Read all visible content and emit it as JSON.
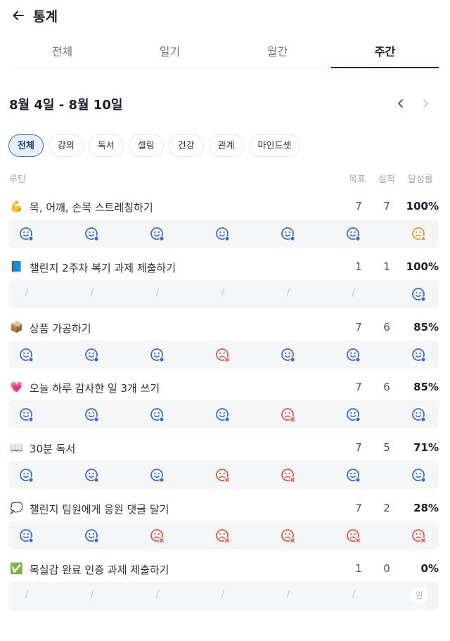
{
  "header": {
    "title": "통계",
    "back_icon": "arrow-left-icon"
  },
  "tabs": [
    {
      "label": "전체",
      "active": false
    },
    {
      "label": "일기",
      "active": false
    },
    {
      "label": "월간",
      "active": false
    },
    {
      "label": "주간",
      "active": true
    }
  ],
  "date_range": "8월 4일 - 8월 10일",
  "nav": {
    "prev_icon": "chevron-left-icon",
    "next_icon": "chevron-right-icon"
  },
  "chips": [
    {
      "label": "전체",
      "active": true
    },
    {
      "label": "강의",
      "active": false
    },
    {
      "label": "독서",
      "active": false
    },
    {
      "label": "셀링",
      "active": false
    },
    {
      "label": "건강",
      "active": false
    },
    {
      "label": "관계",
      "active": false
    },
    {
      "label": "마인드셋",
      "active": false
    }
  ],
  "columns": {
    "routine": "루틴",
    "goal": "목표",
    "actual": "실적",
    "rate": "달성률"
  },
  "colors": {
    "done": "#3a6cd9",
    "fail": "#e05a45",
    "warn": "#f0962e",
    "accent": "#1e2a4a"
  },
  "routines": [
    {
      "emoji": "💪",
      "name": "목, 어깨, 손목 스트레칭하기",
      "goal": "7",
      "actual": "7",
      "rate": "100%",
      "days": [
        "done",
        "done",
        "done",
        "done",
        "done",
        "done",
        "warn"
      ]
    },
    {
      "emoji": "📘",
      "name": "챌린지 2주차 복기 과제 제출하기",
      "goal": "1",
      "actual": "1",
      "rate": "100%",
      "days": [
        "none",
        "none",
        "none",
        "none",
        "none",
        "none",
        "done"
      ]
    },
    {
      "emoji": "📦",
      "name": "상품 가공하기",
      "goal": "7",
      "actual": "6",
      "rate": "85%",
      "days": [
        "done",
        "done",
        "done",
        "fail",
        "done",
        "done",
        "done"
      ]
    },
    {
      "emoji": "💗",
      "name": "오늘 하루 감사한 일 3개 쓰기",
      "goal": "7",
      "actual": "6",
      "rate": "85%",
      "days": [
        "done",
        "done",
        "done",
        "done",
        "fail",
        "done",
        "done"
      ]
    },
    {
      "emoji": "📖",
      "name": "30분 독서",
      "goal": "7",
      "actual": "5",
      "rate": "71%",
      "days": [
        "done",
        "done",
        "done",
        "fail",
        "fail",
        "done",
        "done"
      ]
    },
    {
      "emoji": "💭",
      "name": "챌린지 팀원에게 응원 댓글 달기",
      "goal": "7",
      "actual": "2",
      "rate": "28%",
      "days": [
        "done",
        "done",
        "fail",
        "fail",
        "fail",
        "fail",
        "fail"
      ]
    },
    {
      "emoji": "✅",
      "name": "목실감 완료 인증 과제 제출하기",
      "goal": "1",
      "actual": "0",
      "rate": "0%",
      "days": [
        "none",
        "none",
        "none",
        "none",
        "none",
        "none",
        "today"
      ],
      "today_label": "일"
    }
  ],
  "slash_text": "/"
}
